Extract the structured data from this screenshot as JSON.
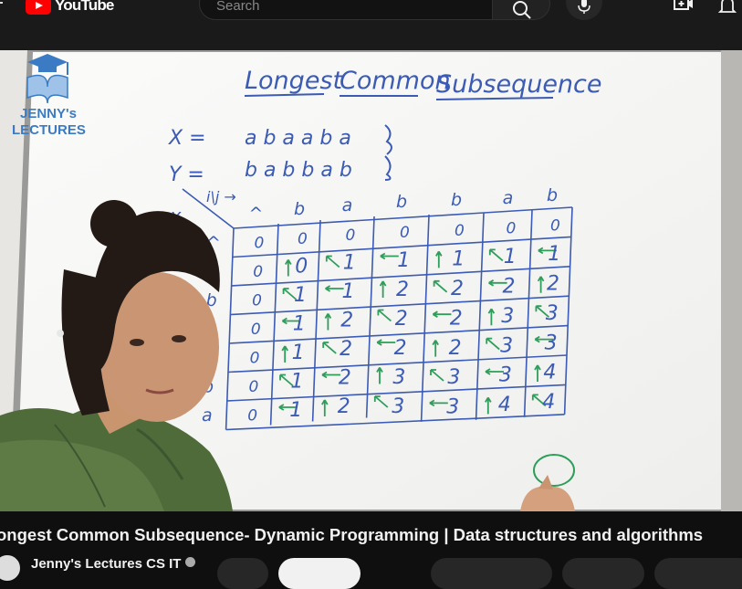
{
  "header": {
    "logo_text": "YouTube",
    "search_placeholder": "Search",
    "icons": [
      "menu-icon",
      "youtube-logo-icon",
      "search-icon",
      "microphone-icon",
      "create-video-icon",
      "notifications-bell-icon"
    ]
  },
  "video": {
    "logo_line1": "JENNY's",
    "logo_line2": "LECTURES",
    "board": {
      "title_words": [
        "Longest",
        "Common",
        "Subsequence"
      ],
      "x_label": "X =",
      "x_sequence": "a b a a b a",
      "y_label": "Y =",
      "y_sequence": "b a b b a b",
      "corner_label": "i\\j →",
      "column_headers": [
        "^",
        "b",
        "a",
        "b",
        "b",
        "a",
        "b"
      ],
      "row_headers": [
        "^",
        "a",
        "b",
        "a",
        "a",
        "b",
        "a"
      ],
      "table": [
        [
          "0",
          "0",
          "0",
          "0",
          "0",
          "0",
          "0"
        ],
        [
          "0",
          "0",
          "1",
          "1",
          "1",
          "1",
          "1"
        ],
        [
          "0",
          "1",
          "1",
          "2",
          "2",
          "2",
          "2"
        ],
        [
          "0",
          "1",
          "2",
          "2",
          "2",
          "3",
          "3"
        ],
        [
          "0",
          "1",
          "2",
          "2",
          "2",
          "3",
          "3"
        ],
        [
          "0",
          "1",
          "2",
          "3",
          "3",
          "3",
          "4"
        ],
        [
          "0",
          "1",
          "2",
          "3",
          "3",
          "4",
          "4"
        ]
      ]
    }
  },
  "title": "ongest Common Subsequence- Dynamic Programming | Data structures and algorithms",
  "channel": {
    "name": "Jenny's Lectures CS IT"
  },
  "colors": {
    "accent": "#ff0000",
    "background": "#0f0f0f",
    "marker_blue": "#3b5bb5",
    "arrow_green": "#2e9e5a"
  }
}
